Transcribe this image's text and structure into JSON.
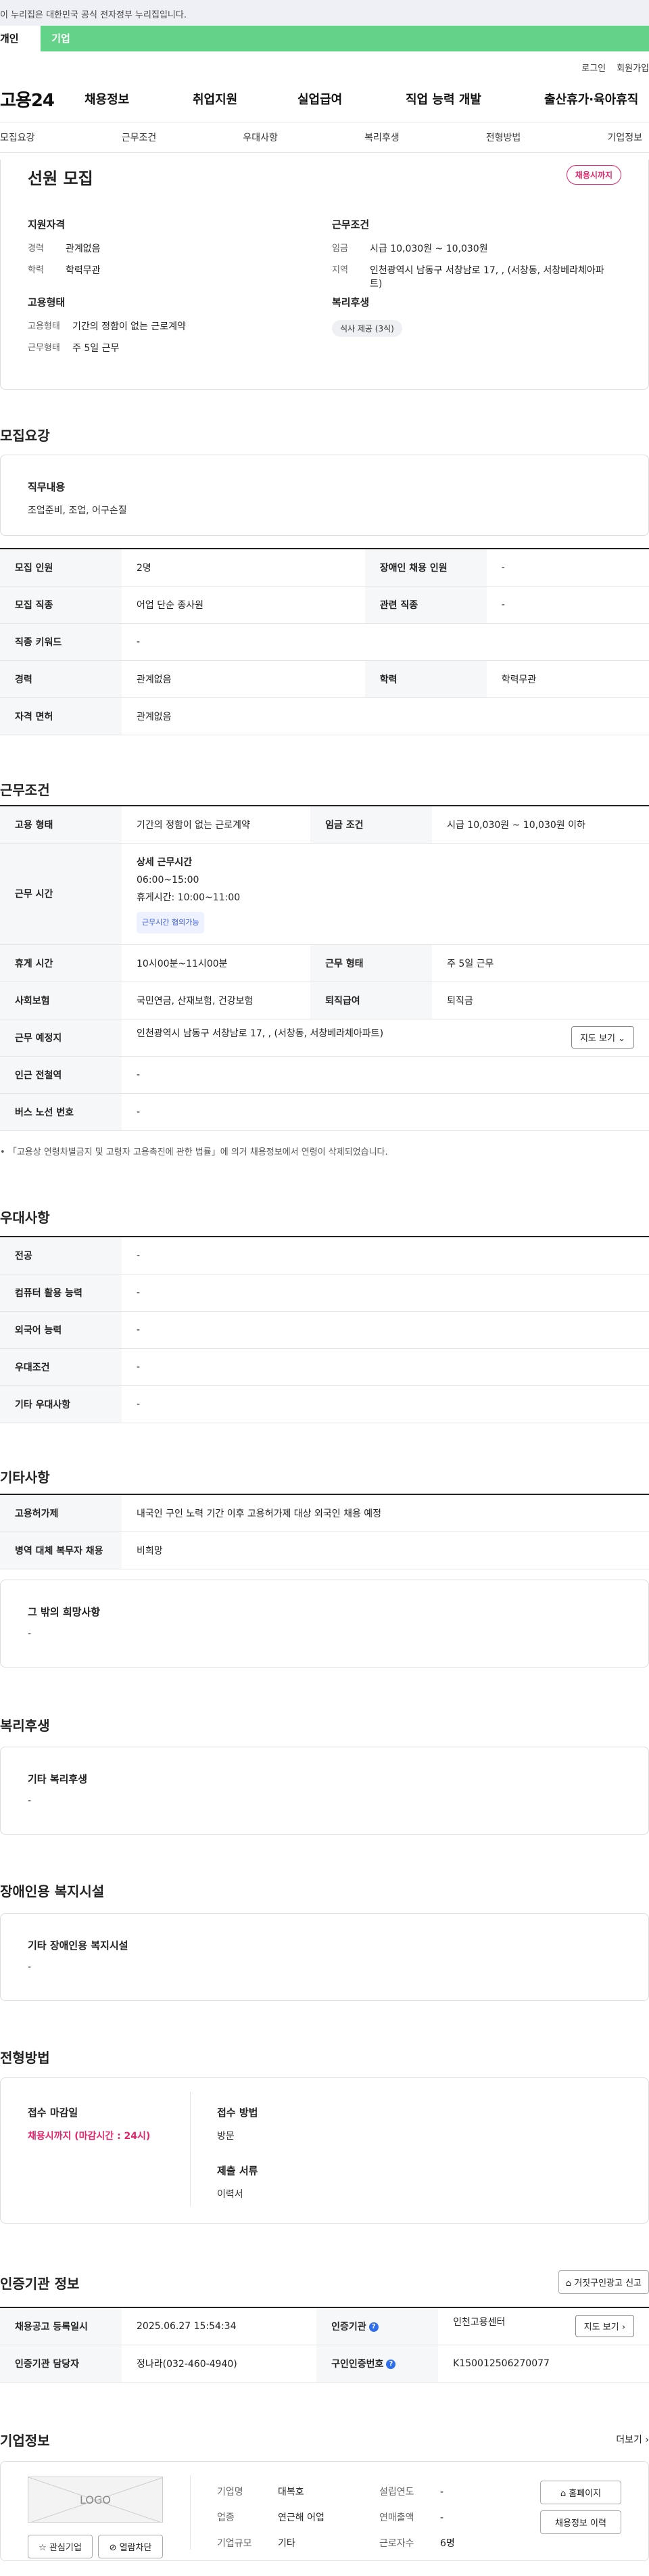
{
  "gov": {
    "text": "이 누리집은 대한민국 공식 전자정부 누리집입니다."
  },
  "usertabs": {
    "tab1": "개인",
    "tab2": "기업"
  },
  "util": {
    "login": "로그인",
    "join": "회원가입"
  },
  "gnb": {
    "logo": "고용24",
    "items": [
      "채용정보",
      "취업지원",
      "실업급여",
      "직업 능력 개발",
      "출산휴가·육아휴직"
    ]
  },
  "snb": [
    "모집요강",
    "근무조건",
    "우대사항",
    "복리후생",
    "전형방법",
    "기업정보"
  ],
  "top": {
    "title": "선원 모집",
    "badge": "채용시까지",
    "qual": {
      "h": "지원자격",
      "rows": [
        {
          "k": "경력",
          "v": "관계없음"
        },
        {
          "k": "학력",
          "v": "학력무관"
        }
      ]
    },
    "cond": {
      "h": "근무조건",
      "rows": [
        {
          "k": "임금",
          "v": "시급 10,030원 ~ 10,030원"
        },
        {
          "k": "지역",
          "v": "인천광역시 남동구 서창남로 17, , (서창동, 서창베라체아파트)"
        }
      ]
    },
    "emp": {
      "h": "고용형태",
      "rows": [
        {
          "k": "고용형태",
          "v": "기간의 정함이 없는 근로계약"
        },
        {
          "k": "근무형태",
          "v": "주 5일 근무"
        }
      ]
    },
    "welfare": {
      "h": "복리후생",
      "chip": "식사 제공 (3식)"
    }
  },
  "recruit": {
    "h": "모집요강",
    "duty_h": "직무내용",
    "duty_v": "조업준비, 조업, 어구손질",
    "rows": [
      [
        "모집 인원",
        "2명",
        "장애인 채용 인원",
        "-"
      ],
      [
        "모집 직종",
        "어업 단순 종사원",
        "관련 직종",
        "-"
      ],
      [
        "직종 키워드",
        "-"
      ],
      [
        "경력",
        "관계없음",
        "학력",
        "학력무관"
      ],
      [
        "자격 면허",
        "관계없음"
      ]
    ]
  },
  "work": {
    "h": "근무조건",
    "emp": [
      "고용 형태",
      "기간의 정함이 없는 근로계약",
      "임금 조건",
      "시급 10,030원 ~ 10,030원 이하"
    ],
    "time": {
      "th": "근무 시간",
      "h": "상세 근무시간",
      "v1": "06:00~15:00",
      "v2": "휴게시간: 10:00~11:00",
      "link": "근무시간 협의가능"
    },
    "rest": [
      "휴게 시간",
      "10시00분~11시00분",
      "근무 형태",
      "주 5일 근무"
    ],
    "ins": [
      "사회보험",
      "국민연금, 산재보험, 건강보험",
      "퇴직급여",
      "퇴직금"
    ],
    "place": [
      "근무 예정지",
      "인천광역시 남동구 서창남로 17, , (서창동, 서창베라체아파트)"
    ],
    "map": "지도 보기",
    "subway": [
      "인근 전철역",
      "-"
    ],
    "bus": [
      "버스 노선 번호",
      "-"
    ],
    "note": "「고용상 연령차별금지 및 고령자 고용촉진에 관한 법률」에 의거 채용정보에서 연령이 삭제되었습니다."
  },
  "pref": {
    "h": "우대사항",
    "rows": [
      [
        "전공",
        "-"
      ],
      [
        "컴퓨터 활용 능력",
        "-"
      ],
      [
        "외국어 능력",
        "-"
      ],
      [
        "우대조건",
        "-"
      ],
      [
        "기타 우대사항",
        "-"
      ]
    ]
  },
  "etc": {
    "h": "기타사항",
    "rows": [
      [
        "고용허가제",
        "내국인 구인 노력 기간 이후 고용허가제 대상 외국인 채용 예정"
      ],
      [
        "병역 대체 복무자 채용",
        "비희망"
      ]
    ],
    "wish_h": "그 밖의 희망사항",
    "wish_v": "-"
  },
  "welfare2": {
    "h": "복리후생",
    "bt": "기타 복리후생",
    "bv": "-"
  },
  "disab": {
    "h": "장애인용 복지시설",
    "bt": "기타 장애인용 복지시설",
    "bv": "-"
  },
  "screen": {
    "h": "전형방법",
    "dl_h": "접수 마감일",
    "dl_v": "채용시까지 (마감시간 : 24시)",
    "m_h": "접수 방법",
    "m_v": "방문",
    "d_h": "제출 서류",
    "d_v": "이력서"
  },
  "agency": {
    "h": "인증기관 정보",
    "report": "거짓구인광고 신고",
    "r1": [
      "채용공고 등록일시",
      "2025.06.27 15:54:34",
      "인증기관",
      "인천고용센터"
    ],
    "r2": [
      "인증기관 담당자",
      "정나라(032-460-4940)",
      "구인인증번호",
      "K150012506270077"
    ],
    "map": "지도 보기",
    "q": "?"
  },
  "company": {
    "h": "기업정보",
    "more": "더보기",
    "logo": "LOGO",
    "fav": "관심기업",
    "block": "열람차단",
    "f": [
      [
        "기업명",
        "대복호",
        "설립연도",
        "-"
      ],
      [
        "업종",
        "연근해 어업",
        "연매출액",
        "-"
      ],
      [
        "기업규모",
        "기타",
        "근로자수",
        "6명"
      ]
    ],
    "home": "홈페이지",
    "jobs": "채용정보 이력"
  }
}
